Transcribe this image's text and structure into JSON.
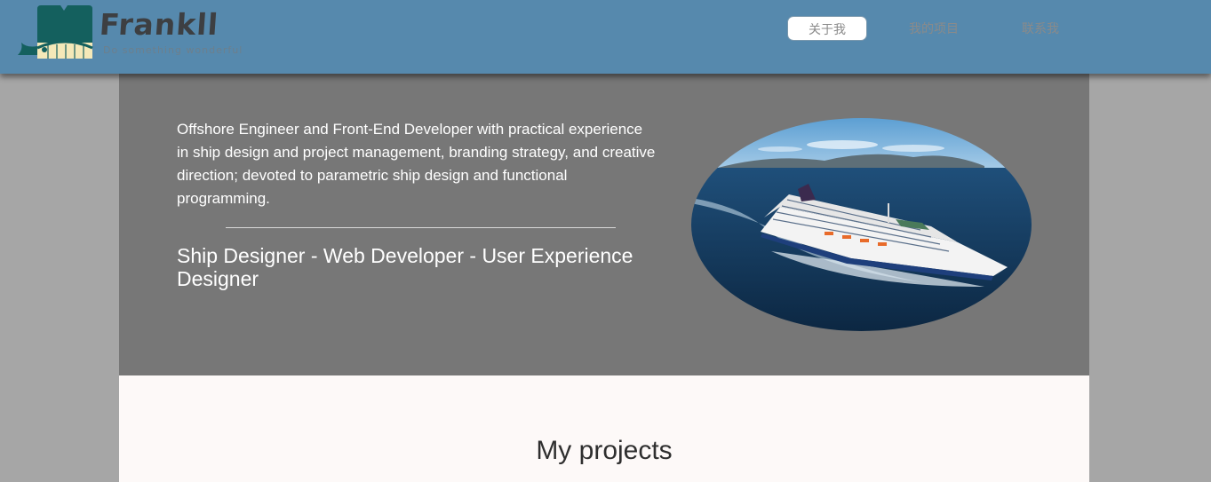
{
  "header": {
    "brand_name": "Frankll",
    "tagline": "Do something wonderful"
  },
  "nav": {
    "items": [
      {
        "label": "关于我",
        "active": true
      },
      {
        "label": "我的项目",
        "active": false
      },
      {
        "label": "联系我",
        "active": false
      }
    ]
  },
  "hero": {
    "intro": "Offshore Engineer and Front-End Developer with practical experience in ship design and project management, branding strategy, and creative direction; devoted to parametric ship design and functional programming.",
    "roles": "Ship Designer - Web Developer - User Experience Designer",
    "image": "cruise-ship-photo"
  },
  "projects": {
    "title": "My projects"
  },
  "colors": {
    "header_bg": "#5689ad",
    "page_bg": "#a6a6a6",
    "hero_bg": "#777777",
    "projects_bg": "#fdf9f8"
  }
}
